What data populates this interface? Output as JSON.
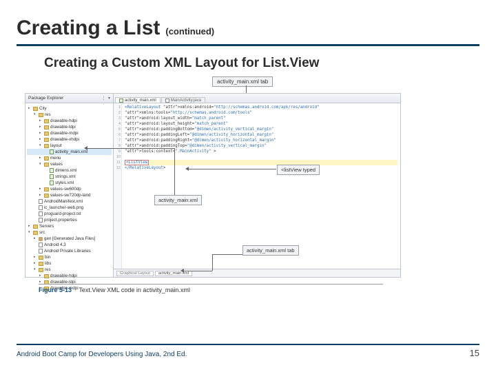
{
  "title": {
    "main": "Creating a List",
    "suffix": "(continued)"
  },
  "subtitle": "Creating a Custom XML Layout for List.View",
  "callouts": {
    "top": "activity_main.xml tab",
    "listview": "<listView typed",
    "midfile": "activity_main.xml",
    "bottomtab": "activity_main.xml tab"
  },
  "pkg": {
    "header": "Package Explorer",
    "icons": "⋮ ▾",
    "rows": [
      {
        "ind": 0,
        "tri": "▸",
        "ico": "fld",
        "txt": "City"
      },
      {
        "ind": 1,
        "tri": "▾",
        "ico": "fld",
        "txt": "res"
      },
      {
        "ind": 2,
        "tri": "▸",
        "ico": "fld",
        "txt": "drawable-hdpi"
      },
      {
        "ind": 2,
        "tri": "▸",
        "ico": "fld",
        "txt": "drawable-ldpi"
      },
      {
        "ind": 2,
        "tri": "▸",
        "ico": "fld",
        "txt": "drawable-mdpi"
      },
      {
        "ind": 2,
        "tri": "▸",
        "ico": "fld",
        "txt": "drawable-xhdpi"
      },
      {
        "ind": 2,
        "tri": "▾",
        "ico": "fld",
        "txt": "layout"
      },
      {
        "ind": 3,
        "tri": "",
        "ico": "xfile",
        "txt": "activity_main.xml",
        "sel": true
      },
      {
        "ind": 2,
        "tri": "▸",
        "ico": "fld",
        "txt": "menu"
      },
      {
        "ind": 2,
        "tri": "▾",
        "ico": "fld",
        "txt": "values"
      },
      {
        "ind": 3,
        "tri": "",
        "ico": "xfile",
        "txt": "dimens.xml"
      },
      {
        "ind": 3,
        "tri": "",
        "ico": "xfile",
        "txt": "strings.xml"
      },
      {
        "ind": 3,
        "tri": "",
        "ico": "xfile",
        "txt": "styles.xml"
      },
      {
        "ind": 2,
        "tri": "▸",
        "ico": "fld",
        "txt": "values-sw600dp"
      },
      {
        "ind": 2,
        "tri": "▸",
        "ico": "fld",
        "txt": "values-sw720dp-land"
      },
      {
        "ind": 1,
        "tri": "",
        "ico": "file",
        "txt": "AndroidManifest.xml"
      },
      {
        "ind": 1,
        "tri": "",
        "ico": "file",
        "txt": "ic_launcher-web.png"
      },
      {
        "ind": 1,
        "tri": "",
        "ico": "file",
        "txt": "proguard-project.txt"
      },
      {
        "ind": 1,
        "tri": "",
        "ico": "file",
        "txt": "project.properties"
      },
      {
        "ind": 0,
        "tri": "▸",
        "ico": "fld",
        "txt": "Servers"
      },
      {
        "ind": 0,
        "tri": "▾",
        "ico": "fld",
        "txt": "src"
      },
      {
        "ind": 1,
        "tri": "▸",
        "ico": "pkg",
        "txt": "gen [Generated Java Files]"
      },
      {
        "ind": 1,
        "tri": "",
        "ico": "file",
        "txt": "Android 4.3"
      },
      {
        "ind": 1,
        "tri": "",
        "ico": "file",
        "txt": "Android Private Libraries"
      },
      {
        "ind": 1,
        "tri": "▸",
        "ico": "fld",
        "txt": "bin"
      },
      {
        "ind": 1,
        "tri": "▸",
        "ico": "fld",
        "txt": "libs"
      },
      {
        "ind": 1,
        "tri": "▾",
        "ico": "fld",
        "txt": "res"
      },
      {
        "ind": 2,
        "tri": "▸",
        "ico": "fld",
        "txt": "drawable-hdpi"
      },
      {
        "ind": 2,
        "tri": "▸",
        "ico": "fld",
        "txt": "drawable-ldpi"
      },
      {
        "ind": 2,
        "tri": "▸",
        "ico": "fld",
        "txt": "drawable-mdpi"
      }
    ]
  },
  "editor": {
    "active_tab": "activity_main.xml",
    "inactive_tab": "MainActivity.java",
    "lower_tab_left": "Graphical Layout",
    "lower_tab_right": "activity_main.xml",
    "lines": [
      {
        "n": 1,
        "t": "<RelativeLayout xmlns:android=\"http://schemas.android.com/apk/res/android\""
      },
      {
        "n": 2,
        "t": "    xmlns:tools=\"http://schemas.android.com/tools\""
      },
      {
        "n": 3,
        "t": "    android:layout_width=\"match_parent\""
      },
      {
        "n": 4,
        "t": "    android:layout_height=\"match_parent\""
      },
      {
        "n": 5,
        "t": "    android:paddingBottom=\"@dimen/activity_vertical_margin\""
      },
      {
        "n": 6,
        "t": "    android:paddingLeft=\"@dimen/activity_horizontal_margin\""
      },
      {
        "n": 7,
        "t": "    android:paddingRight=\"@dimen/activity_horizontal_margin\""
      },
      {
        "n": 8,
        "t": "    android:paddingTop=\"@dimen/activity_vertical_margin\""
      },
      {
        "n": 9,
        "t": "    tools:context=\".MainActivity\" >"
      },
      {
        "n": 10,
        "t": ""
      },
      {
        "n": 11,
        "t": "    <ListView",
        "hl": true,
        "box": true
      },
      {
        "n": 12,
        "t": "</RelativeLayout>"
      }
    ]
  },
  "caption": {
    "no": "Figure 5-13",
    "txt": "Text.View XML code in activity_main.xml"
  },
  "footer": {
    "left": "Android Boot Camp for Developers Using Java, 2nd Ed.",
    "right": "15"
  }
}
